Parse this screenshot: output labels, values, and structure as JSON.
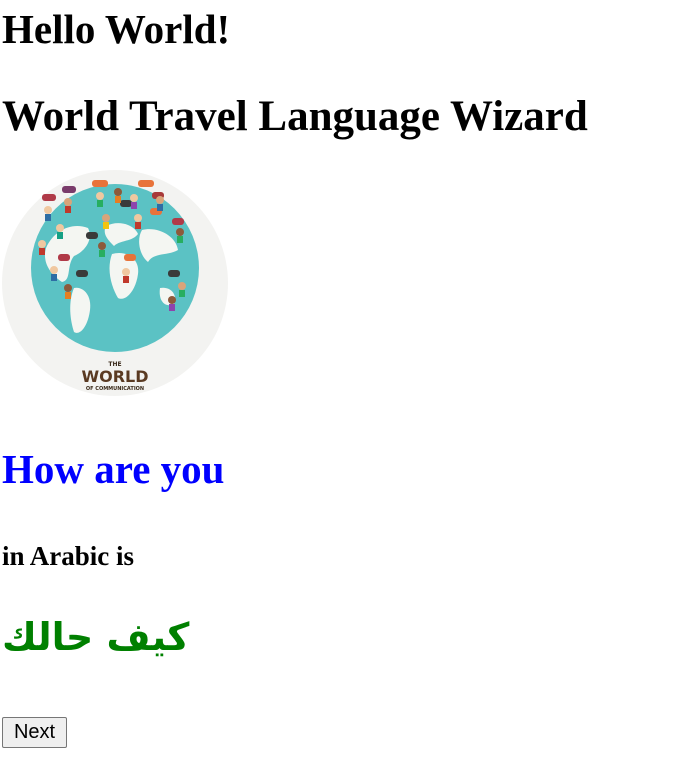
{
  "header": {
    "greeting": "Hello World!",
    "app_title": "World Travel Language Wizard"
  },
  "image": {
    "logo_text_main": "WORLD",
    "logo_text_top": "THE",
    "logo_text_bottom": "OF COMMUNICATION"
  },
  "phrase": {
    "text": "How are you",
    "color": "#0000ff"
  },
  "language_line": "in Arabic is",
  "translation": {
    "text": "كيف حالك",
    "color": "#008000"
  },
  "actions": {
    "next_label": "Next"
  }
}
